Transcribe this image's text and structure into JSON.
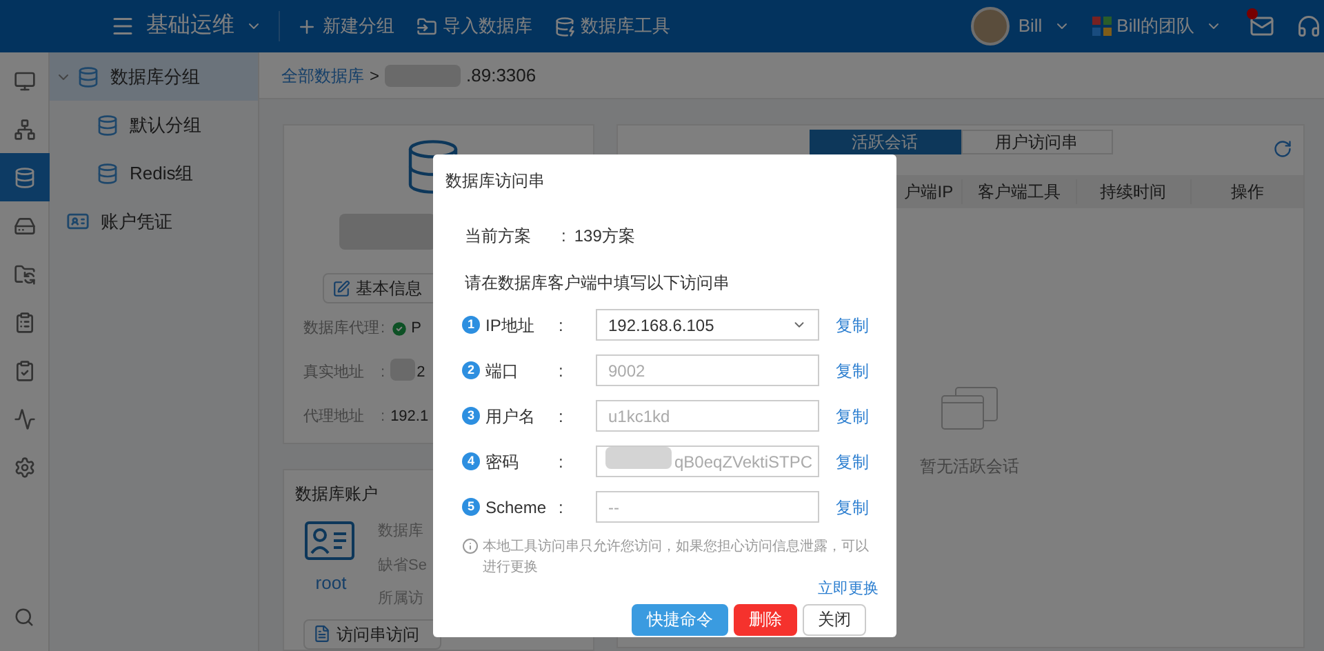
{
  "header": {
    "title": "基础运维",
    "actions": [
      {
        "label": "新建分组"
      },
      {
        "label": "导入数据库"
      },
      {
        "label": "数据库工具"
      }
    ],
    "user": "Bill",
    "team": "Bill的团队",
    "unread": true
  },
  "rail": [
    {
      "selected": false
    },
    {
      "selected": false
    },
    {
      "selected": true
    },
    {
      "selected": false
    },
    {
      "selected": false
    },
    {
      "selected": false
    },
    {
      "selected": false
    },
    {
      "selected": false
    },
    {
      "selected": false
    }
  ],
  "tree": [
    {
      "label": "数据库分组",
      "selected": true,
      "expanded": true,
      "children": [
        {
          "label": "默认分组",
          "selected": false
        },
        {
          "label": "Redis组",
          "selected": false
        }
      ]
    },
    {
      "label": "账户凭证",
      "selected": false
    }
  ],
  "breadcrumb": {
    "root": "全部数据库",
    "separator": ">",
    "current": ".89:3306"
  },
  "db_card": {
    "info_button": "基本信息",
    "rows": [
      {
        "label": "数据库代理",
        "sep": ":",
        "value": "P",
        "kind": "status"
      },
      {
        "label": "真实地址",
        "sep": ":",
        "value": "2",
        "kind": "masked"
      },
      {
        "label": "代理地址",
        "sep": ":",
        "value": "192.1",
        "kind": "text"
      }
    ]
  },
  "accounts": {
    "title": "数据库账户",
    "account": "root",
    "details": [
      "数据库",
      "缺省Se",
      "所属访"
    ],
    "button": "访问串访问"
  },
  "sessions": {
    "tabs": [
      {
        "label": "活跃会话",
        "selected": true
      },
      {
        "label": "用户访问串",
        "selected": false
      }
    ],
    "columns": [
      "户端IP",
      "客户端工具",
      "持续时间",
      "操作"
    ],
    "empty": "暂无活跃会话"
  },
  "dialog": {
    "title": "数据库访问串",
    "scheme_label": "当前方案",
    "scheme_sep": ":",
    "scheme_value": "139方案",
    "instruction": "请在数据库客户端中填写以下访问串",
    "fields": [
      {
        "number": "1",
        "label": "IP地址",
        "sep": ":",
        "kind": "select",
        "value": "192.168.6.105",
        "copy": "复制"
      },
      {
        "number": "2",
        "label": "端口",
        "sep": ":",
        "kind": "input",
        "value": "9002",
        "copy": "复制"
      },
      {
        "number": "3",
        "label": "用户名",
        "sep": ":",
        "kind": "input",
        "value": "u1kc1kd",
        "copy": "复制"
      },
      {
        "number": "4",
        "label": "密码",
        "sep": ":",
        "kind": "masked",
        "value": "qB0eqZVektiSTPC",
        "copy": "复制"
      },
      {
        "number": "5",
        "label": "Scheme",
        "sep": ":",
        "kind": "input",
        "placeholder": "--",
        "copy": "复制"
      }
    ],
    "note": "本地工具访问串只允许您访问，如果您担心访问信息泄露，可以进行更换",
    "note_link": "立即更换",
    "buttons": [
      {
        "label": "快捷命令",
        "kind": "primary"
      },
      {
        "label": "删除",
        "kind": "danger"
      },
      {
        "label": "关闭",
        "kind": "default"
      }
    ]
  }
}
